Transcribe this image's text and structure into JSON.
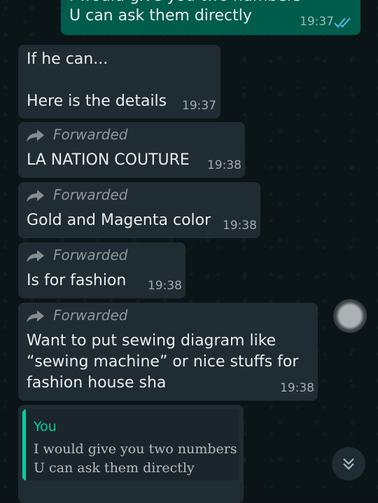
{
  "messages": [
    {
      "id": "m0",
      "direction": "outgoing",
      "lines": [
        "I would give you two numbers",
        "U can ask them directly"
      ],
      "time": "19:37",
      "status": "read"
    },
    {
      "id": "m1",
      "direction": "incoming",
      "lines": [
        "If he can...",
        "",
        "Here is the details"
      ],
      "time": "19:37"
    },
    {
      "id": "m2",
      "direction": "incoming",
      "forwarded": true,
      "forwarded_label": "Forwarded",
      "lines": [
        "LA NATION COUTURE"
      ],
      "time": "19:38"
    },
    {
      "id": "m3",
      "direction": "incoming",
      "forwarded": true,
      "forwarded_label": "Forwarded",
      "lines": [
        "Gold and Magenta color"
      ],
      "time": "19:38"
    },
    {
      "id": "m4",
      "direction": "incoming",
      "forwarded": true,
      "forwarded_label": "Forwarded",
      "lines": [
        "Is for fashion"
      ],
      "time": "19:38"
    },
    {
      "id": "m5",
      "direction": "incoming",
      "forwarded": true,
      "forwarded_label": "Forwarded",
      "lines": [
        "Want to put sewing diagram like",
        "“sewing machine” or nice stuffs for",
        "fashion house sha"
      ],
      "time": "19:38"
    },
    {
      "id": "m6",
      "direction": "incoming",
      "quote": {
        "author": "You",
        "lines": [
          "I would give you two numbers",
          "U can ask them directly"
        ]
      }
    }
  ],
  "colors": {
    "incoming": "#202c33",
    "outgoing": "#005c4b",
    "quote_accent": "#06cf9c",
    "read_ticks": "#53bdeb"
  },
  "icons": {
    "forward": "forward-arrow-icon",
    "read": "double-check-icon",
    "scroll": "chevron-double-down-icon"
  }
}
